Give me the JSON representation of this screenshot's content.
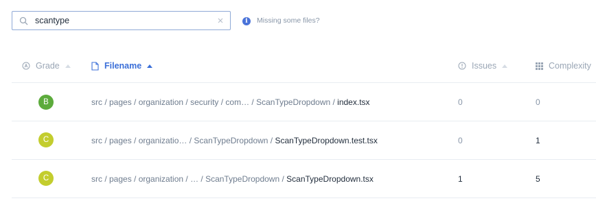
{
  "search": {
    "value": "scantype",
    "placeholder": ""
  },
  "missing_files_link": "Missing some files?",
  "columns": {
    "grade": "Grade",
    "filename": "Filename",
    "issues": "Issues",
    "complexity": "Complexity"
  },
  "rows": [
    {
      "grade": "B",
      "grade_color": "#5cab3c",
      "path_prefix": "src / pages / organization / security / com…  / ScanTypeDropdown / ",
      "file": "index.tsx",
      "issues": "0",
      "complexity": "0"
    },
    {
      "grade": "C",
      "grade_color": "#c3cd2e",
      "path_prefix": "src / pages / organizatio…  / ScanTypeDropdown / ",
      "file": "ScanTypeDropdown.test.tsx",
      "issues": "0",
      "complexity": "1"
    },
    {
      "grade": "C",
      "grade_color": "#c3cd2e",
      "path_prefix": "src / pages / organization / …   / ScanTypeDropdown / ",
      "file": "ScanTypeDropdown.tsx",
      "issues": "1",
      "complexity": "5"
    }
  ],
  "colors": {
    "accent": "#3b6fd8",
    "grade_b": "#5cab3c",
    "grade_c": "#c3cd2e"
  }
}
